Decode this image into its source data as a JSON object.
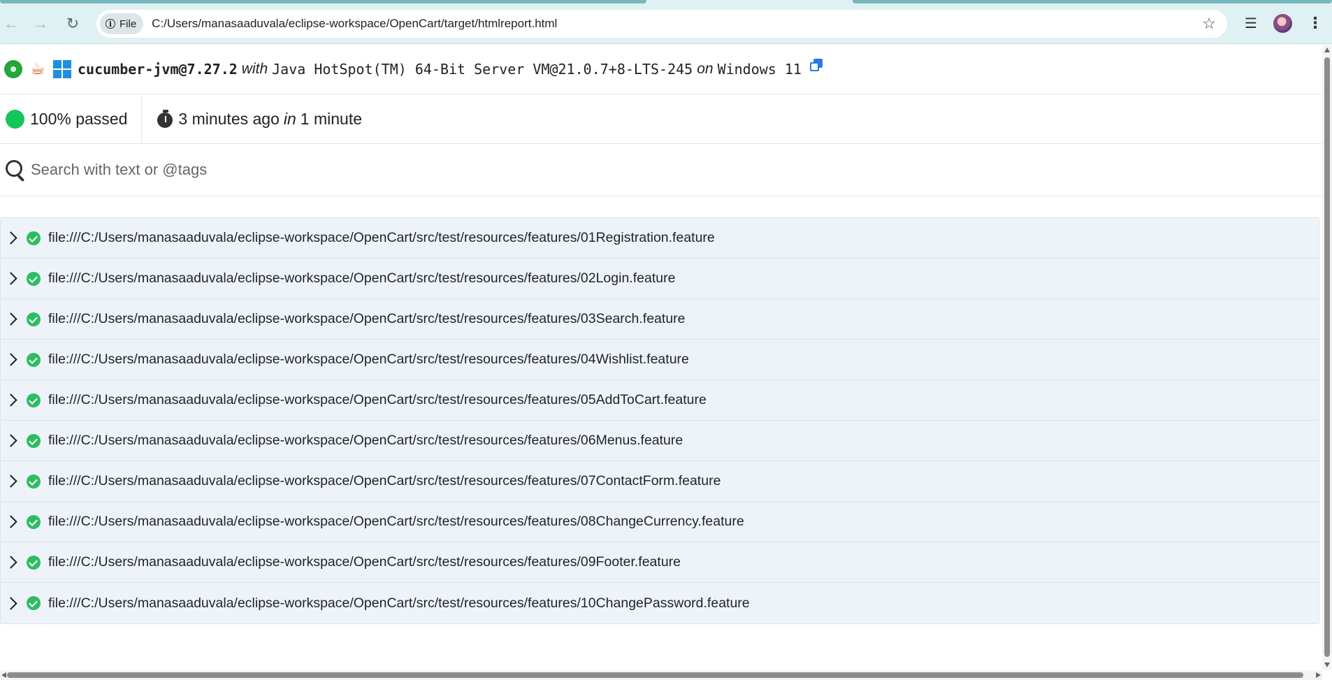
{
  "browser": {
    "file_chip_label": "File",
    "url": "C:/Users/manasaaduvala/eclipse-workspace/OpenCart/target/htmlreport.html",
    "icons": {
      "back": "arrow-left-icon",
      "forward": "arrow-right-icon",
      "reload": "reload-icon",
      "info": "info-icon",
      "bookmark": "star-icon",
      "media": "playlist-icon",
      "profile": "avatar",
      "menu": "more-vertical-icon"
    }
  },
  "report": {
    "environment": {
      "implementation": "cucumber-jvm@7.27.2",
      "with_label": "with",
      "runtime": "Java HotSpot(TM) 64-Bit Server VM@21.0.7+8-LTS-245",
      "on_label": "on",
      "os": "Windows 11"
    },
    "status": {
      "passed_text": "100% passed",
      "started_text": "3 minutes ago",
      "in_label": "in",
      "duration_text": "1 minute"
    },
    "search": {
      "placeholder": "Search with text or @tags"
    },
    "features": [
      "file:///C:/Users/manasaaduvala/eclipse-workspace/OpenCart/src/test/resources/features/01Registration.feature",
      "file:///C:/Users/manasaaduvala/eclipse-workspace/OpenCart/src/test/resources/features/02Login.feature",
      "file:///C:/Users/manasaaduvala/eclipse-workspace/OpenCart/src/test/resources/features/03Search.feature",
      "file:///C:/Users/manasaaduvala/eclipse-workspace/OpenCart/src/test/resources/features/04Wishlist.feature",
      "file:///C:/Users/manasaaduvala/eclipse-workspace/OpenCart/src/test/resources/features/05AddToCart.feature",
      "file:///C:/Users/manasaaduvala/eclipse-workspace/OpenCart/src/test/resources/features/06Menus.feature",
      "file:///C:/Users/manasaaduvala/eclipse-workspace/OpenCart/src/test/resources/features/07ContactForm.feature",
      "file:///C:/Users/manasaaduvala/eclipse-workspace/OpenCart/src/test/resources/features/08ChangeCurrency.feature",
      "file:///C:/Users/manasaaduvala/eclipse-workspace/OpenCart/src/test/resources/features/09Footer.feature",
      "file:///C:/Users/manasaaduvala/eclipse-workspace/OpenCart/src/test/resources/features/10ChangePassword.feature"
    ],
    "colors": {
      "passed": "#16c55a",
      "feature_passed": "#2ebd63",
      "copy_icon": "#2b79e4",
      "list_background": "#eef3f9"
    }
  }
}
